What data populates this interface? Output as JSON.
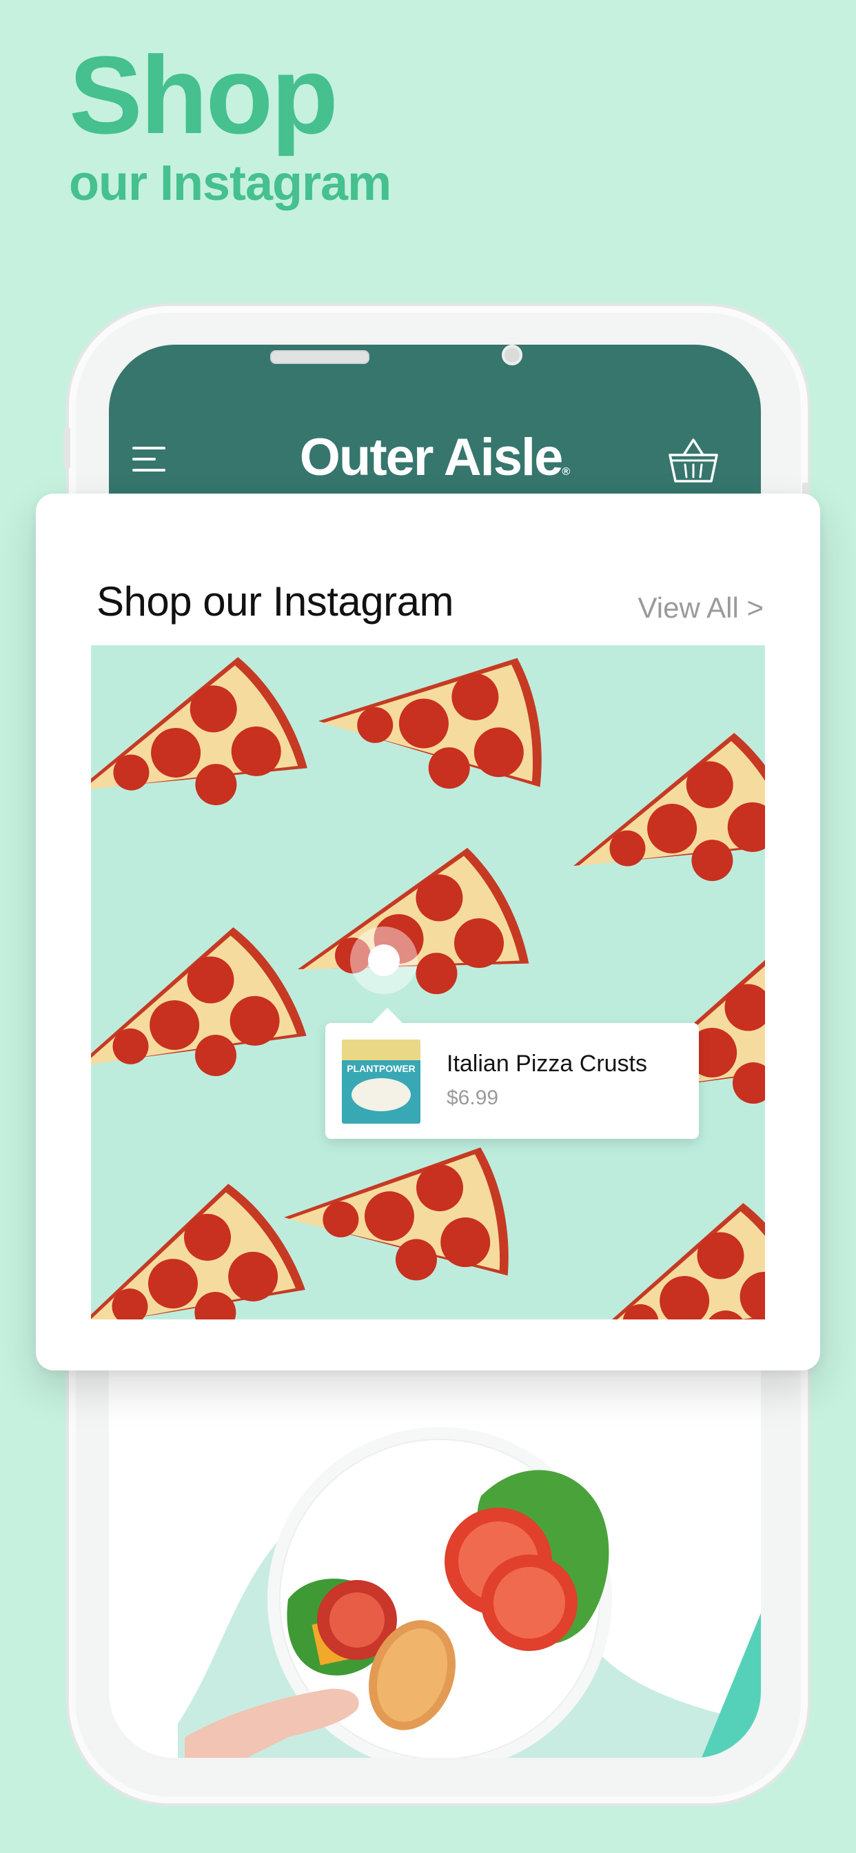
{
  "headline": {
    "line1": "Shop",
    "line2": "our Instagram"
  },
  "app": {
    "logo": "Outer Aisle",
    "logo_mark": "®"
  },
  "card": {
    "title": "Shop our Instagram",
    "view_all": "View All >",
    "product": {
      "name": "Italian Pizza Crusts",
      "price": "$6.99",
      "package_label": "PLANTPOWER"
    }
  },
  "colors": {
    "background": "#c6f1df",
    "accent": "#45c08e",
    "appbar": "#36766d",
    "instagram_bg": "#bdecdd"
  },
  "icons": {
    "menu": "hamburger-menu-icon",
    "cart": "basket-icon"
  }
}
